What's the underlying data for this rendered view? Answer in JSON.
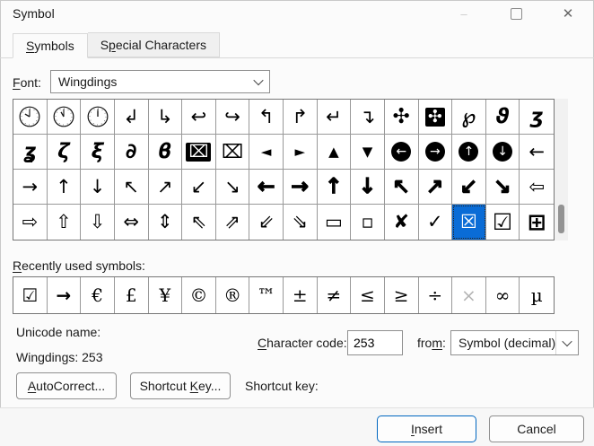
{
  "window": {
    "title": "Symbol",
    "controls": {
      "minimize": "–",
      "close": "✕"
    }
  },
  "tabs": {
    "symbols": {
      "pre": "",
      "accel": "S",
      "post": "ymbols"
    },
    "special": {
      "pre": "S",
      "accel": "p",
      "post": "ecial Characters"
    }
  },
  "font_row": {
    "label": {
      "pre": "",
      "accel": "F",
      "post": "ont:"
    },
    "value": "Wingdings"
  },
  "grid": {
    "selected_code": "253",
    "cells": [
      {
        "clock": 10
      },
      {
        "clock": 11
      },
      {
        "clock": 12
      },
      {
        "g": "↲"
      },
      {
        "g": "↳"
      },
      {
        "g": "↩"
      },
      {
        "g": "↪"
      },
      {
        "g": "↰"
      },
      {
        "g": "↱"
      },
      {
        "g": "↵"
      },
      {
        "g": "↴"
      },
      {
        "g": "✣",
        "cls": "pin"
      },
      {
        "g": "✣",
        "cls": "inv"
      },
      {
        "g": "℘",
        "cls": "ink"
      },
      {
        "g": "ϑ",
        "cls": "ink"
      },
      {
        "g": "ʒ",
        "cls": "ink"
      },
      {
        "g": "ʓ",
        "cls": "ink"
      },
      {
        "g": "ζ",
        "cls": "ink"
      },
      {
        "g": "ξ",
        "cls": "ink"
      },
      {
        "g": "∂",
        "cls": "ink"
      },
      {
        "g": "ϐ",
        "cls": "ink"
      },
      {
        "g": "⌧",
        "cls": "inv"
      },
      {
        "g": "⌧"
      },
      {
        "g": "◄",
        "cls": "ah"
      },
      {
        "g": "►",
        "cls": "ah"
      },
      {
        "g": "▲",
        "cls": "ah"
      },
      {
        "g": "▼",
        "cls": "ah"
      },
      {
        "g": "←",
        "cls": "circ"
      },
      {
        "g": "→",
        "cls": "circ"
      },
      {
        "g": "↑",
        "cls": "circ"
      },
      {
        "g": "↓",
        "cls": "circ"
      },
      {
        "g": "←"
      },
      {
        "g": "→"
      },
      {
        "g": "↑"
      },
      {
        "g": "↓"
      },
      {
        "g": "↖"
      },
      {
        "g": "↗"
      },
      {
        "g": "↙"
      },
      {
        "g": "↘"
      },
      {
        "g": "←",
        "cls": "hv"
      },
      {
        "g": "→",
        "cls": "hv"
      },
      {
        "g": "↑",
        "cls": "hv"
      },
      {
        "g": "↓",
        "cls": "hv"
      },
      {
        "g": "↖",
        "cls": "hv"
      },
      {
        "g": "↗",
        "cls": "hv"
      },
      {
        "g": "↙",
        "cls": "hv"
      },
      {
        "g": "↘",
        "cls": "hv"
      },
      {
        "g": "⇦"
      },
      {
        "g": "⇨"
      },
      {
        "g": "⇧"
      },
      {
        "g": "⇩"
      },
      {
        "g": "⇔"
      },
      {
        "g": "⇕"
      },
      {
        "g": "⇖"
      },
      {
        "g": "⇗"
      },
      {
        "g": "⇙"
      },
      {
        "g": "⇘"
      },
      {
        "g": "▭"
      },
      {
        "g": "▫"
      },
      {
        "g": "✘"
      },
      {
        "g": "✓"
      },
      {
        "g": "☒",
        "sel": true
      },
      {
        "g": "☑",
        "cls": "big"
      },
      {
        "g": "⊞",
        "cls": "big"
      }
    ]
  },
  "recent": {
    "label": {
      "pre": "",
      "accel": "R",
      "post": "ecently used symbols:"
    },
    "cells": [
      {
        "g": "☑",
        "cls": "wd"
      },
      {
        "g": "→",
        "cls": "wd"
      },
      {
        "g": "€"
      },
      {
        "g": "£"
      },
      {
        "g": "¥"
      },
      {
        "g": "©"
      },
      {
        "g": "®"
      },
      {
        "g": "™"
      },
      {
        "g": "±"
      },
      {
        "g": "≠"
      },
      {
        "g": "≤"
      },
      {
        "g": "≥"
      },
      {
        "g": "÷"
      },
      {
        "g": "×",
        "cls": "dim"
      },
      {
        "g": "∞"
      },
      {
        "g": "µ"
      }
    ]
  },
  "info": {
    "unicode_name_label": "Unicode name:",
    "unicode_name_value": "Wingdings: 253",
    "char_code": {
      "label": {
        "pre": "",
        "accel": "C",
        "post": "haracter code:"
      },
      "value": "253"
    },
    "from": {
      "label": {
        "pre": "fro",
        "accel": "m",
        "post": ":"
      },
      "value": "Symbol (decimal)"
    }
  },
  "actions": {
    "autocorrect": {
      "pre": "",
      "accel": "A",
      "post": "utoCorrect..."
    },
    "shortcut_key": {
      "pre": "Shortcut ",
      "accel": "K",
      "post": "ey..."
    },
    "shortcut_label": "Shortcut key:"
  },
  "footer": {
    "insert": {
      "pre": "",
      "accel": "I",
      "post": "nsert"
    },
    "cancel": "Cancel"
  },
  "colors": {
    "selection_blue": "#0a6cd6",
    "insert_border_blue": "#0067c0"
  }
}
